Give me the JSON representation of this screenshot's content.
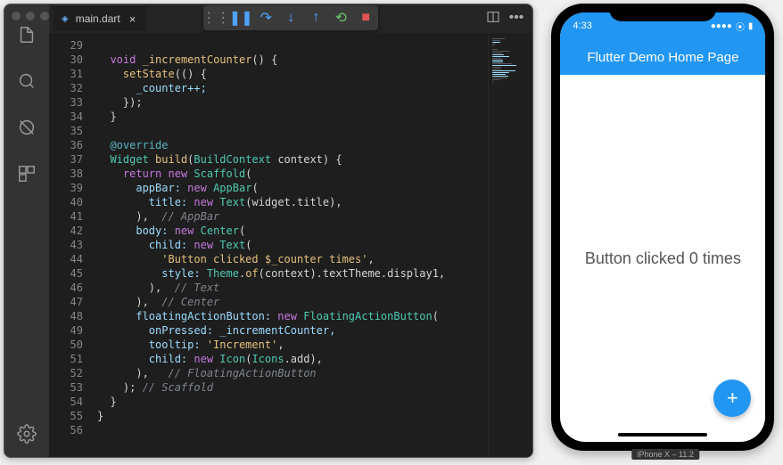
{
  "ide": {
    "tab": {
      "filename": "main.dart"
    },
    "line_start": 29,
    "line_end": 56,
    "code_lines": [
      [
        [
          "",
          ""
        ]
      ],
      [
        [
          "  ",
          "pun"
        ],
        [
          "void",
          "key"
        ],
        [
          " ",
          ""
        ],
        [
          "_incrementCounter",
          "fn"
        ],
        [
          "() {",
          "pun"
        ]
      ],
      [
        [
          "    ",
          "pun"
        ],
        [
          "setState",
          "call"
        ],
        [
          "(() {",
          "pun"
        ]
      ],
      [
        [
          "      _counter++;",
          "var"
        ]
      ],
      [
        [
          "    });",
          "pun"
        ]
      ],
      [
        [
          "  }",
          "pun"
        ]
      ],
      [
        [
          "",
          ""
        ]
      ],
      [
        [
          "  ",
          "pun"
        ],
        [
          "@override",
          "anno"
        ]
      ],
      [
        [
          "  ",
          "pun"
        ],
        [
          "Widget",
          "type"
        ],
        [
          " ",
          ""
        ],
        [
          "build",
          "fn"
        ],
        [
          "(",
          "pun"
        ],
        [
          "BuildContext",
          "type"
        ],
        [
          " context) {",
          "pun"
        ]
      ],
      [
        [
          "    ",
          "pun"
        ],
        [
          "return",
          "key"
        ],
        [
          " ",
          ""
        ],
        [
          "new",
          "key"
        ],
        [
          " ",
          ""
        ],
        [
          "Scaffold",
          "new"
        ],
        [
          "(",
          "pun"
        ]
      ],
      [
        [
          "      appBar: ",
          "var"
        ],
        [
          "new",
          "key"
        ],
        [
          " ",
          ""
        ],
        [
          "AppBar",
          "new"
        ],
        [
          "(",
          "pun"
        ]
      ],
      [
        [
          "        title: ",
          "var"
        ],
        [
          "new",
          "key"
        ],
        [
          " ",
          ""
        ],
        [
          "Text",
          "new"
        ],
        [
          "(widget.title),",
          "pun"
        ]
      ],
      [
        [
          "      ),  ",
          "pun"
        ],
        [
          "// AppBar",
          "com"
        ]
      ],
      [
        [
          "      body: ",
          "var"
        ],
        [
          "new",
          "key"
        ],
        [
          " ",
          ""
        ],
        [
          "Center",
          "new"
        ],
        [
          "(",
          "pun"
        ]
      ],
      [
        [
          "        child: ",
          "var"
        ],
        [
          "new",
          "key"
        ],
        [
          " ",
          ""
        ],
        [
          "Text",
          "new"
        ],
        [
          "(",
          "pun"
        ]
      ],
      [
        [
          "          ",
          "pun"
        ],
        [
          "'Button clicked $_counter times'",
          "str"
        ],
        [
          ",",
          "pun"
        ]
      ],
      [
        [
          "          style: ",
          "var"
        ],
        [
          "Theme",
          "type"
        ],
        [
          ".",
          "pun"
        ],
        [
          "of",
          "call"
        ],
        [
          "(context).textTheme.display1,",
          "pun"
        ]
      ],
      [
        [
          "        ),  ",
          "pun"
        ],
        [
          "// Text",
          "com"
        ]
      ],
      [
        [
          "      ),  ",
          "pun"
        ],
        [
          "// Center",
          "com"
        ]
      ],
      [
        [
          "      floatingActionButton: ",
          "var"
        ],
        [
          "new",
          "key"
        ],
        [
          " ",
          ""
        ],
        [
          "FloatingActionButton",
          "new"
        ],
        [
          "(",
          "pun"
        ]
      ],
      [
        [
          "        onPressed: _incrementCounter,",
          "var"
        ]
      ],
      [
        [
          "        tooltip: ",
          "var"
        ],
        [
          "'Increment'",
          "str"
        ],
        [
          ",",
          "pun"
        ]
      ],
      [
        [
          "        child: ",
          "var"
        ],
        [
          "new",
          "key"
        ],
        [
          " ",
          ""
        ],
        [
          "Icon",
          "new"
        ],
        [
          "(",
          "pun"
        ],
        [
          "Icons",
          "type"
        ],
        [
          ".add),",
          "pun"
        ]
      ],
      [
        [
          "      ),   ",
          "pun"
        ],
        [
          "// FloatingActionButton",
          "com"
        ]
      ],
      [
        [
          "    ); ",
          "pun"
        ],
        [
          "// Scaffold",
          "com"
        ]
      ],
      [
        [
          "  }",
          "pun"
        ]
      ],
      [
        [
          "}",
          "pun"
        ]
      ],
      [
        [
          "",
          ""
        ]
      ]
    ]
  },
  "simulator": {
    "device_label": "iPhone X – 11.2",
    "status_time": "4:33",
    "appbar_title": "Flutter Demo Home Page",
    "body_text": "Button clicked 0 times",
    "fab_glyph": "+"
  },
  "signal_glyph": "●●●●",
  "wifi_glyph": "⦿",
  "battery_glyph": "▮"
}
